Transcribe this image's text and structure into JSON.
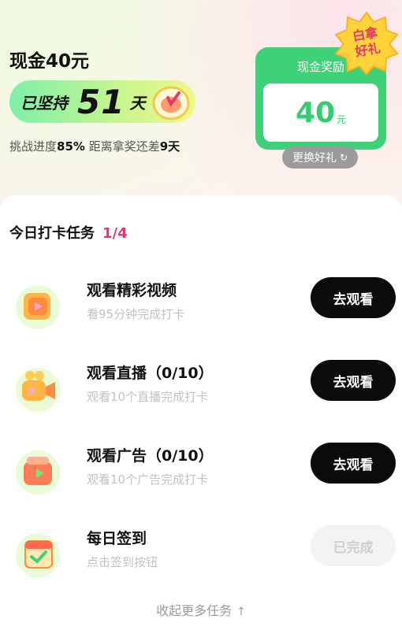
{
  "header": {
    "title": "现金40元",
    "streak_prefix": "已坚持",
    "streak_days": "51",
    "streak_suffix": "天",
    "progress_label": "挑战进度",
    "progress_value": "85%",
    "remaining_label": "距离拿奖还差",
    "remaining_value": "9天"
  },
  "reward": {
    "title": "现金奖励",
    "amount": "40",
    "unit": "元",
    "badge_line1": "白拿",
    "badge_line2": "好礼",
    "swap_label": "更换好礼",
    "swap_icon": "refresh-icon"
  },
  "tasks_section": {
    "title": "今日打卡任务",
    "count": "1/4",
    "items": [
      {
        "name": "观看精彩视频",
        "desc": "看95分钟完成打卡",
        "button": "去观看",
        "done": false,
        "icon": "video-icon"
      },
      {
        "name": "观看直播（0/10）",
        "desc": "观看10个直播完成打卡",
        "button": "去观看",
        "done": false,
        "icon": "live-camera-icon"
      },
      {
        "name": "观看广告（0/10）",
        "desc": "观看10个广告完成打卡",
        "button": "去观看",
        "done": false,
        "icon": "ad-icon"
      },
      {
        "name": "每日签到",
        "desc": "点击签到按钮",
        "button": "已完成",
        "done": true,
        "icon": "calendar-check-icon"
      }
    ],
    "collapse_label": "收起更多任务",
    "collapse_icon": "arrow-up-icon"
  },
  "colors": {
    "accent_green": "#3fd178",
    "accent_pink": "#e8366c",
    "button_dark": "#0b0b0b"
  }
}
